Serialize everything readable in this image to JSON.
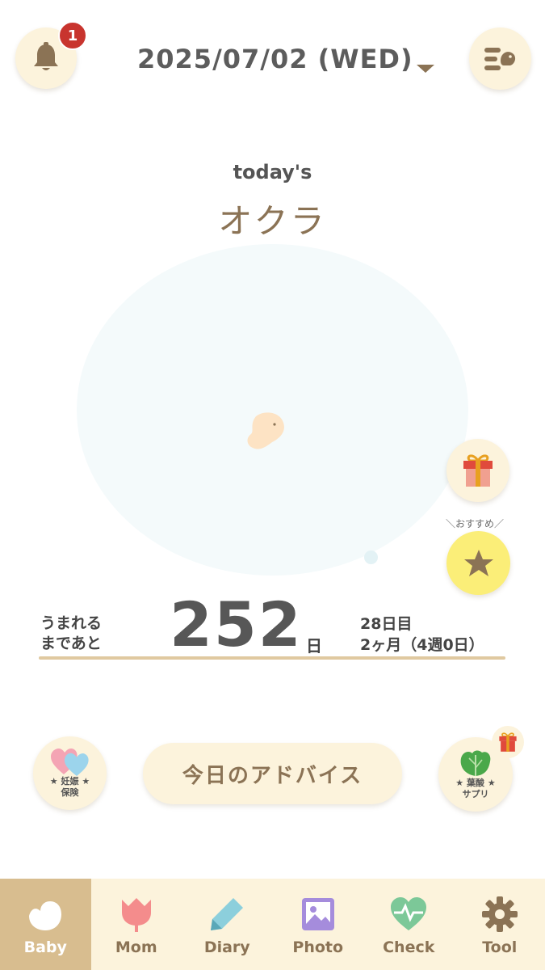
{
  "header": {
    "date": "2025/07/02 (WED)",
    "notification_count": "1",
    "bell_icon": "bell-icon",
    "menu_icon": "menu-icon"
  },
  "main": {
    "today_label": "today's",
    "fruit_name": "オクラ",
    "recommend_label": "＼おすすめ／"
  },
  "countdown": {
    "label_line1": "うまれる",
    "label_line2": "まであと",
    "days": "252",
    "unit": "日",
    "day_count": "28日目",
    "month_week": "2ヶ月（4週0日）"
  },
  "actions": {
    "insurance_line1": "★ 妊娠 ★",
    "insurance_line2": "保険",
    "advice_label": "今日のアドバイス",
    "supplement_line1": "★ 葉酸 ★",
    "supplement_line2": "サプリ"
  },
  "tabs": [
    {
      "label": "Baby",
      "icon": "bird-icon",
      "active": true
    },
    {
      "label": "Mom",
      "icon": "tulip-icon",
      "active": false
    },
    {
      "label": "Diary",
      "icon": "pencil-icon",
      "active": false
    },
    {
      "label": "Photo",
      "icon": "photo-icon",
      "active": false
    },
    {
      "label": "Check",
      "icon": "heart-pulse-icon",
      "active": false
    },
    {
      "label": "Tool",
      "icon": "gear-icon",
      "active": false
    }
  ],
  "colors": {
    "accent": "#8b7355",
    "cream": "#fcf3dc",
    "active_tab": "#d8bd8f",
    "badge": "#c8342e",
    "star_button": "#fbee78"
  }
}
